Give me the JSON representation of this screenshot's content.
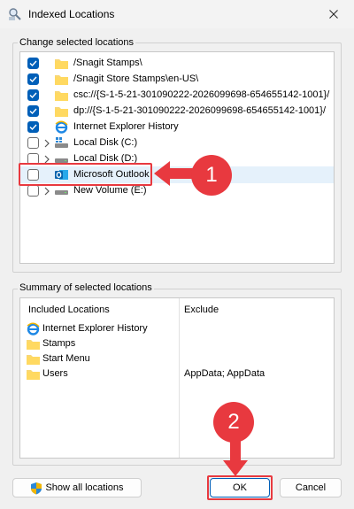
{
  "window": {
    "title": "Indexed Locations"
  },
  "change_group": {
    "label": "Change selected locations",
    "items": [
      {
        "label": "/Snagit Stamps\\",
        "checked": true,
        "icon": "folder-icon"
      },
      {
        "label": "/Snagit Store Stamps\\en-US\\",
        "checked": true,
        "icon": "folder-icon"
      },
      {
        "label": "csc://{S-1-5-21-301090222-2026099698-654655142-1001}/",
        "checked": true,
        "icon": "folder-icon"
      },
      {
        "label": "dp://{S-1-5-21-301090222-2026099698-654655142-1001}/",
        "checked": true,
        "icon": "folder-icon"
      },
      {
        "label": "Internet Explorer History",
        "checked": true,
        "icon": "internet-explorer-icon"
      },
      {
        "label": "Local Disk (C:)",
        "checked": false,
        "icon": "windows-drive-icon"
      },
      {
        "label": "Local Disk (D:)",
        "checked": false,
        "icon": "drive-icon"
      },
      {
        "label": "Microsoft Outlook",
        "checked": false,
        "icon": "outlook-icon"
      },
      {
        "label": "New Volume (E:)",
        "checked": false,
        "icon": "drive-icon"
      }
    ]
  },
  "summary_group": {
    "label": "Summary of selected locations",
    "col_included": "Included Locations",
    "col_exclude": "Exclude",
    "rows": [
      {
        "label": "Internet Explorer History",
        "exclude": "",
        "icon": "internet-explorer-icon"
      },
      {
        "label": "Stamps",
        "exclude": "",
        "icon": "folder-icon"
      },
      {
        "label": "Start Menu",
        "exclude": "",
        "icon": "folder-icon"
      },
      {
        "label": "Users",
        "exclude": "AppData; AppData",
        "icon": "folder-icon"
      }
    ]
  },
  "buttons": {
    "show_all": "Show all locations",
    "ok": "OK",
    "cancel": "Cancel"
  },
  "annotations": {
    "step1": "1",
    "step2": "2",
    "color": "#e8393f"
  }
}
